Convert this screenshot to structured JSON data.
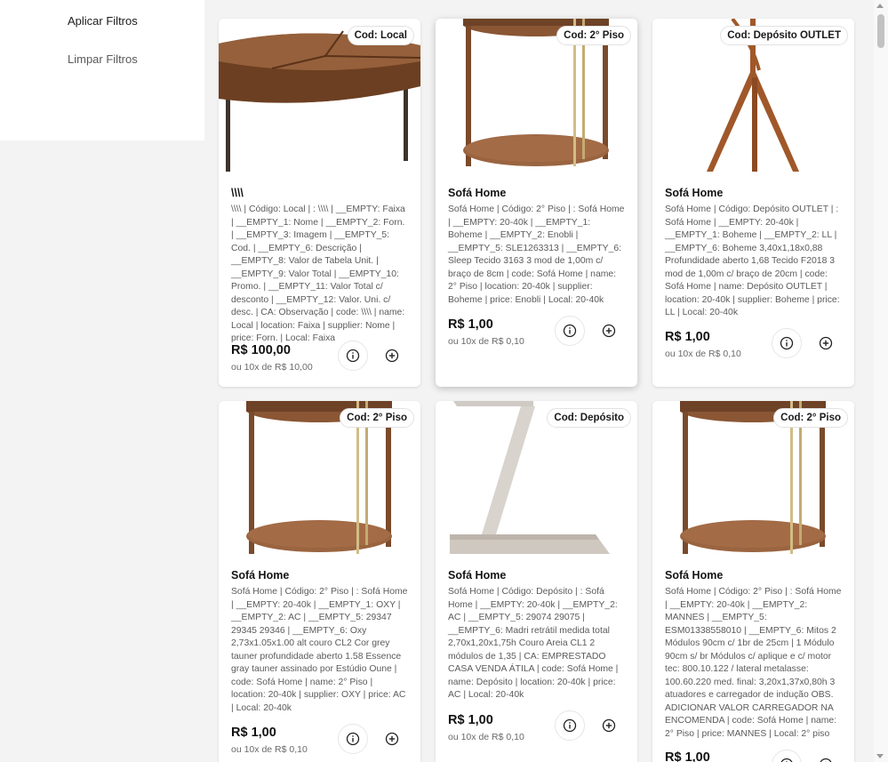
{
  "sidebar": {
    "apply_label": "Aplicar Filtros",
    "clear_label": "Limpar Filtros"
  },
  "products": [
    {
      "badge": "Cod: Local",
      "title": "\\\\\\\\",
      "description": "\\\\\\\\ | Código: Local | : \\\\\\\\ | __EMPTY: Faixa | __EMPTY_1: Nome | __EMPTY_2: Forn. | __EMPTY_3: Imagem | __EMPTY_5: Cod. | __EMPTY_6: Descrição | __EMPTY_8: Valor de Tabela Unit. | __EMPTY_9: Valor Total | __EMPTY_10: Promo. | __EMPTY_11: Valor Total c/ desconto | __EMPTY_12: Valor. Uni. c/ desc. | CA: Observação | code: \\\\\\\\ | name: Local | location: Faixa | supplier: Nome | price: Forn. | Local: Faixa",
      "price": "R$ 100,00",
      "installments": "ou 10x de R$ 10,00",
      "image": "round-wood-coffee-table"
    },
    {
      "badge": "Cod: 2° Piso",
      "title": "Sofá Home",
      "description": "Sofá Home | Código: 2° Piso | : Sofá Home | __EMPTY: 20-40k | __EMPTY_1: Boheme | __EMPTY_2: Enobli | __EMPTY_5: SLE1263313 | __EMPTY_6: Sleep Tecido 3163 3 mod de 1,00m c/ braço de 8cm | code: Sofá Home | name: 2° Piso | location: 20-40k | supplier: Boheme | price: Enobli | Local: 20-40k",
      "price": "R$ 1,00",
      "installments": "ou 10x de R$ 0,10",
      "image": "round-side-table"
    },
    {
      "badge": "Cod: Depósito OUTLET",
      "title": "Sofá Home",
      "description": "Sofá Home | Código: Depósito OUTLET | : Sofá Home | __EMPTY: 20-40k | __EMPTY_1: Boheme | __EMPTY_2: LL | __EMPTY_6: Boheme 3,40x1,18x0,88 Profundidade aberto 1,68 Tecido F2018 3 mod de 1,00m c/ braço de 20cm | code: Sofá Home | name: Depósito OUTLET | location: 20-40k | supplier: Boheme | price: LL | Local: 20-40k",
      "price": "R$ 1,00",
      "installments": "ou 10x de R$ 0,10",
      "image": "wooden-coat-stand"
    },
    {
      "badge": "Cod: 2° Piso",
      "title": "Sofá Home",
      "description": "Sofá Home | Código: 2° Piso | : Sofá Home | __EMPTY: 20-40k | __EMPTY_1: OXY | __EMPTY_2: AC | __EMPTY_5: 29347 29345 29346 | __EMPTY_6: Oxy 2,73x1.05x1.00 alt couro CL2 Cor grey tauner profundidade aberto 1.58 Essence gray tauner assinado por Estúdio Oune | code: Sofá Home | name: 2° Piso | location: 20-40k | supplier: OXY | price: AC | Local: 20-40k",
      "price": "R$ 1,00",
      "installments": "ou 10x de R$ 0,10",
      "image": "round-side-table"
    },
    {
      "badge": "Cod: Depósito",
      "title": "Sofá Home",
      "description": "Sofá Home | Código: Depósito | : Sofá Home | __EMPTY: 20-40k | __EMPTY_2: AC | __EMPTY_5: 29074 29075 | __EMPTY_6: Madri retrátil medida total 2,70x1,20x1,75h Couro Areia CL1 2 módulos de 1,35 | CA: EMPRESTADO CASA VENDA ÁTILA | code: Sofá Home | name: Depósito | location: 20-40k | price: AC | Local: 20-40k",
      "price": "R$ 1,00",
      "installments": "ou 10x de R$ 0,10",
      "image": "z-shaped-side-table"
    },
    {
      "badge": "Cod: 2° Piso",
      "title": "Sofá Home",
      "description": "Sofá Home | Código: 2° Piso | : Sofá Home | __EMPTY: 20-40k | __EMPTY_2: MANNES | __EMPTY_5: ESM01338558010 | __EMPTY_6: Mitos 2 Módulos 90cm c/ 1br de 25cm | 1 Módulo 90cm s/ br Módulos c/ aplique e c/ motor tec: 800.10.122 / lateral metalasse: 100.60.220 med. final: 3,20x1,37x0,80h 3 atuadores e carregador de indução OBS. ADICIONAR VALOR CARREGADOR NA ENCOMENDA | code: Sofá Home | name: 2° Piso | price: MANNES | Local: 2° piso",
      "price": "R$ 1,00",
      "installments": "",
      "image": "round-side-table"
    }
  ],
  "colors": {
    "wood": "#8a5634",
    "brass": "#c9b27a",
    "background": "#f3f3f3"
  }
}
